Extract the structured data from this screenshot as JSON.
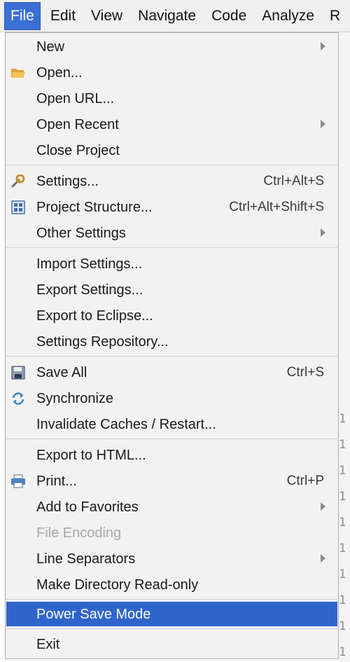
{
  "menubar": {
    "items": [
      "File",
      "Edit",
      "View",
      "Navigate",
      "Code",
      "Analyze",
      "R"
    ]
  },
  "editor": {
    "line_numbers": [
      "1",
      "1",
      "1",
      "1",
      "1",
      "1",
      "1",
      "1",
      "1",
      "1"
    ]
  },
  "file_menu": {
    "items": [
      {
        "label": "New",
        "shortcut": "",
        "submenu": true
      },
      {
        "label": "Open...",
        "shortcut": "",
        "icon": "folder-open-icon"
      },
      {
        "label": "Open URL...",
        "shortcut": ""
      },
      {
        "label": "Open Recent",
        "shortcut": "",
        "submenu": true
      },
      {
        "label": "Close Project",
        "shortcut": ""
      },
      {
        "label": "Settings...",
        "shortcut": "Ctrl+Alt+S",
        "icon": "wrench-icon"
      },
      {
        "label": "Project Structure...",
        "shortcut": "Ctrl+Alt+Shift+S",
        "icon": "project-structure-icon"
      },
      {
        "label": "Other Settings",
        "shortcut": "",
        "submenu": true
      },
      {
        "label": "Import Settings...",
        "shortcut": ""
      },
      {
        "label": "Export Settings...",
        "shortcut": ""
      },
      {
        "label": "Export to Eclipse...",
        "shortcut": ""
      },
      {
        "label": "Settings Repository...",
        "shortcut": ""
      },
      {
        "label": "Save All",
        "shortcut": "Ctrl+S",
        "icon": "save-icon"
      },
      {
        "label": "Synchronize",
        "shortcut": "",
        "icon": "sync-icon"
      },
      {
        "label": "Invalidate Caches / Restart...",
        "shortcut": ""
      },
      {
        "label": "Export to HTML...",
        "shortcut": ""
      },
      {
        "label": "Print...",
        "shortcut": "Ctrl+P",
        "icon": "print-icon"
      },
      {
        "label": "Add to Favorites",
        "shortcut": "",
        "submenu": true
      },
      {
        "label": "File Encoding",
        "shortcut": "",
        "disabled": true
      },
      {
        "label": "Line Separators",
        "shortcut": "",
        "submenu": true
      },
      {
        "label": "Make Directory Read-only",
        "shortcut": ""
      },
      {
        "label": "Power Save Mode",
        "shortcut": "",
        "highlighted": true
      },
      {
        "label": "Exit",
        "shortcut": ""
      }
    ]
  },
  "colors": {
    "highlight": "#2f65ca",
    "menubar_active": "#3b6fd6"
  }
}
